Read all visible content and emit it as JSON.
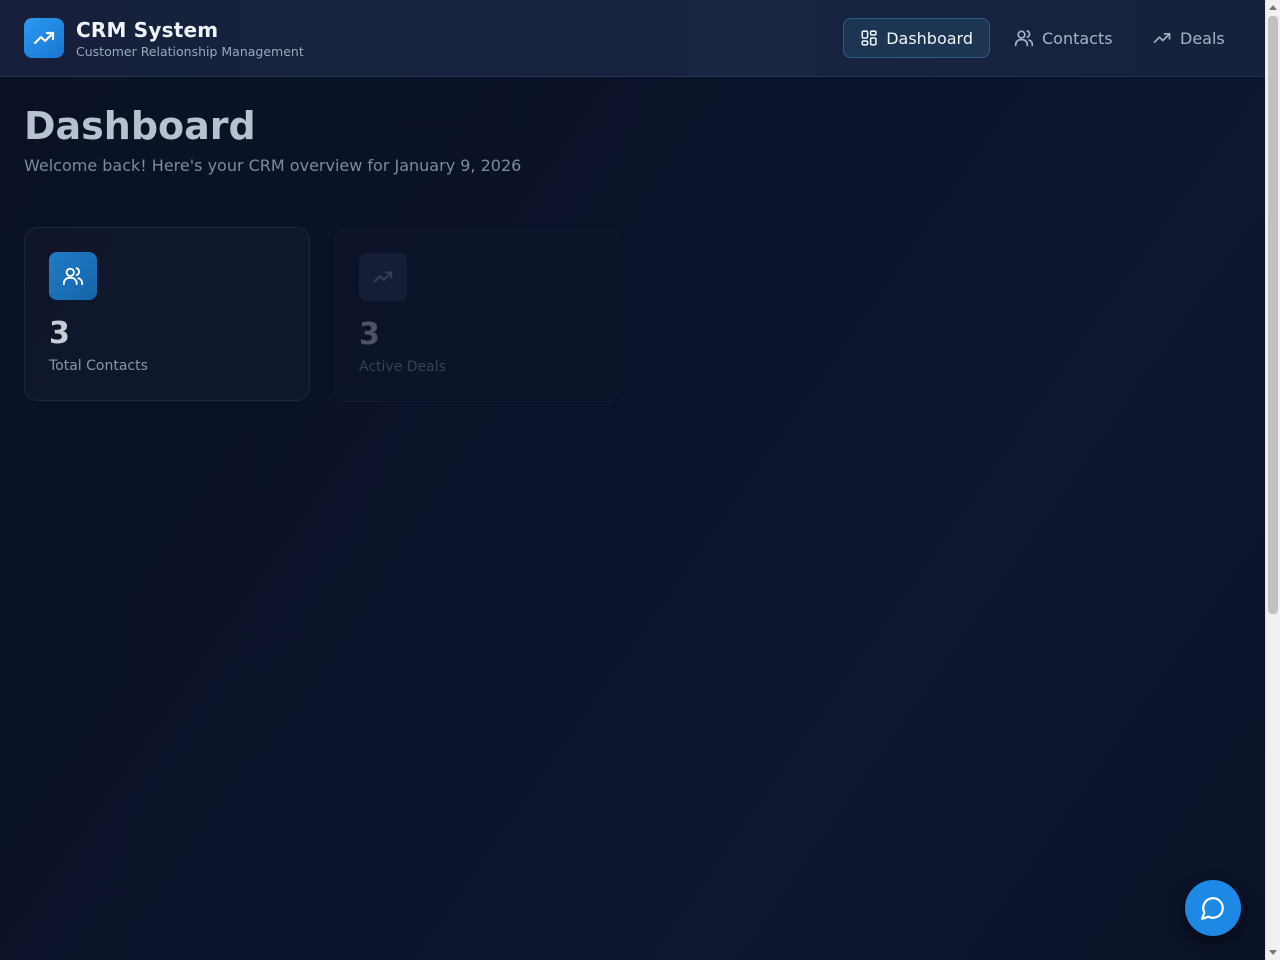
{
  "header": {
    "brand_title": "CRM System",
    "brand_subtitle": "Customer Relationship Management",
    "logo_icon": "trending-up-icon",
    "nav": [
      {
        "label": "Dashboard",
        "icon": "dashboard-grid-icon",
        "active": true
      },
      {
        "label": "Contacts",
        "icon": "users-icon",
        "active": false
      },
      {
        "label": "Deals",
        "icon": "trending-up-icon",
        "active": false
      }
    ]
  },
  "main": {
    "title": "Dashboard",
    "subtitle": "Welcome back! Here's your CRM overview for January 9, 2026",
    "stats": [
      {
        "value": "3",
        "label": "Total Contacts",
        "icon": "users-icon"
      },
      {
        "value": "3",
        "label": "Active Deals",
        "icon": "trending-up-icon"
      }
    ]
  },
  "chat": {
    "icon": "chat-bubble-icon"
  },
  "colors": {
    "accent": "#1e88e5",
    "background": "#0b132a",
    "header": "#172240",
    "active_nav": "#1c3553"
  }
}
